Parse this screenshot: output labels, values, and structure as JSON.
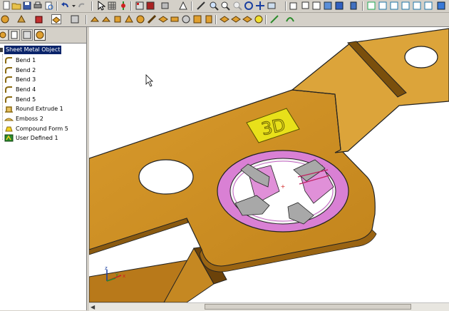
{
  "feature_tree": {
    "root_label": "Sheet Metal Object",
    "items": [
      {
        "label": "Bend 1",
        "icon": "bend-icon"
      },
      {
        "label": "Bend 2",
        "icon": "bend-icon"
      },
      {
        "label": "Bend 3",
        "icon": "bend-icon"
      },
      {
        "label": "Bend 4",
        "icon": "bend-icon"
      },
      {
        "label": "Bend 5",
        "icon": "bend-icon"
      },
      {
        "label": "Round Extrude 1",
        "icon": "round-extrude-icon"
      },
      {
        "label": "Emboss 2",
        "icon": "emboss-icon"
      },
      {
        "label": "Compound Form 5",
        "icon": "compound-form-icon"
      },
      {
        "label": "User Defined 1",
        "icon": "user-defined-icon"
      }
    ]
  },
  "viewport": {
    "emboss_text": "3D",
    "triad_labels": {
      "x": "x",
      "y": "y",
      "z": "z"
    }
  },
  "colors": {
    "sheet_face": "#cc9125",
    "sheet_edge": "#7a4f0c",
    "sheet_light": "#dca43a",
    "form_magenta": "#d980d4",
    "form_grey": "#a8a8a8",
    "emboss_yellow": "#e8e01a",
    "selection": "#0a246a"
  }
}
